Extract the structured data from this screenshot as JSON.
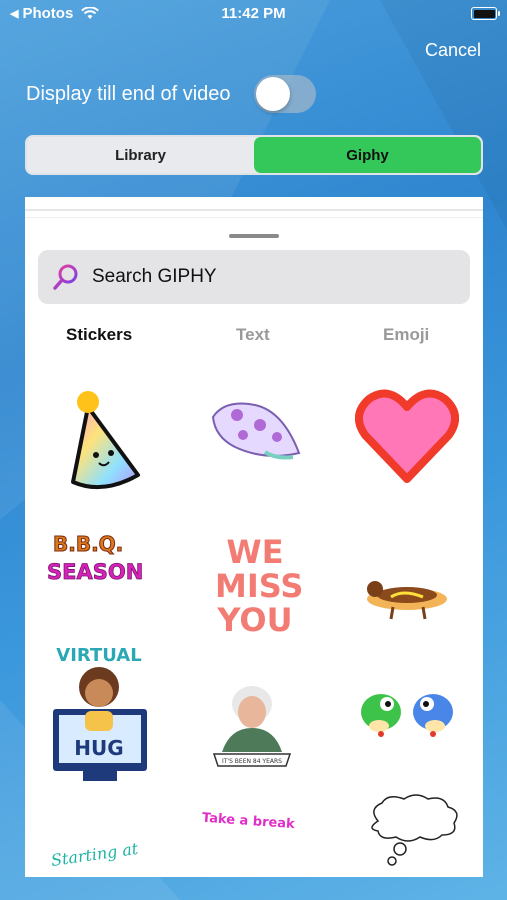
{
  "status_bar": {
    "back_app": "Photos",
    "time": "11:42 PM"
  },
  "header": {
    "cancel": "Cancel",
    "toggle_label": "Display till end of video",
    "toggle_on": false
  },
  "segmented": {
    "items": [
      "Library",
      "Giphy"
    ],
    "selected": "Giphy"
  },
  "search": {
    "placeholder": "Search GIPHY"
  },
  "tabs": [
    "Stickers",
    "Text",
    "Emoji"
  ],
  "stickers": {
    "bbq_line1": "B.B.Q.",
    "bbq_line2": "SEASON",
    "we_miss_you": [
      "WE",
      "MISS",
      "YOU"
    ],
    "virtual": "VIRTUAL",
    "hug": "HUG",
    "take_a_break": "Take a break",
    "its_been_years": "IT'S BEEN 84 YEARS",
    "starting_at": "Starting at"
  },
  "colors": {
    "accent_green": "#34c75a",
    "bg_blue": "#3b8fd6"
  }
}
